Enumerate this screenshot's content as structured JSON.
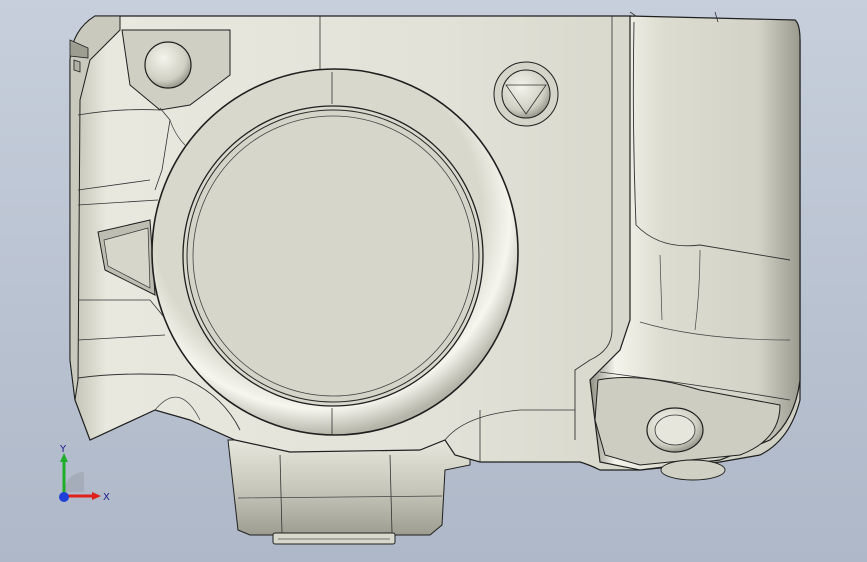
{
  "viewport": {
    "background_top": "#c7cfdc",
    "background_bottom": "#aeb8c8",
    "model_fill": "#dcdcd0",
    "model_edge": "#1f1f1f"
  },
  "triad": {
    "x_label": "X",
    "y_label": "Y",
    "x_color": "#e0201c",
    "y_color": "#1fae2a",
    "z_color": "#1f3fd8"
  }
}
